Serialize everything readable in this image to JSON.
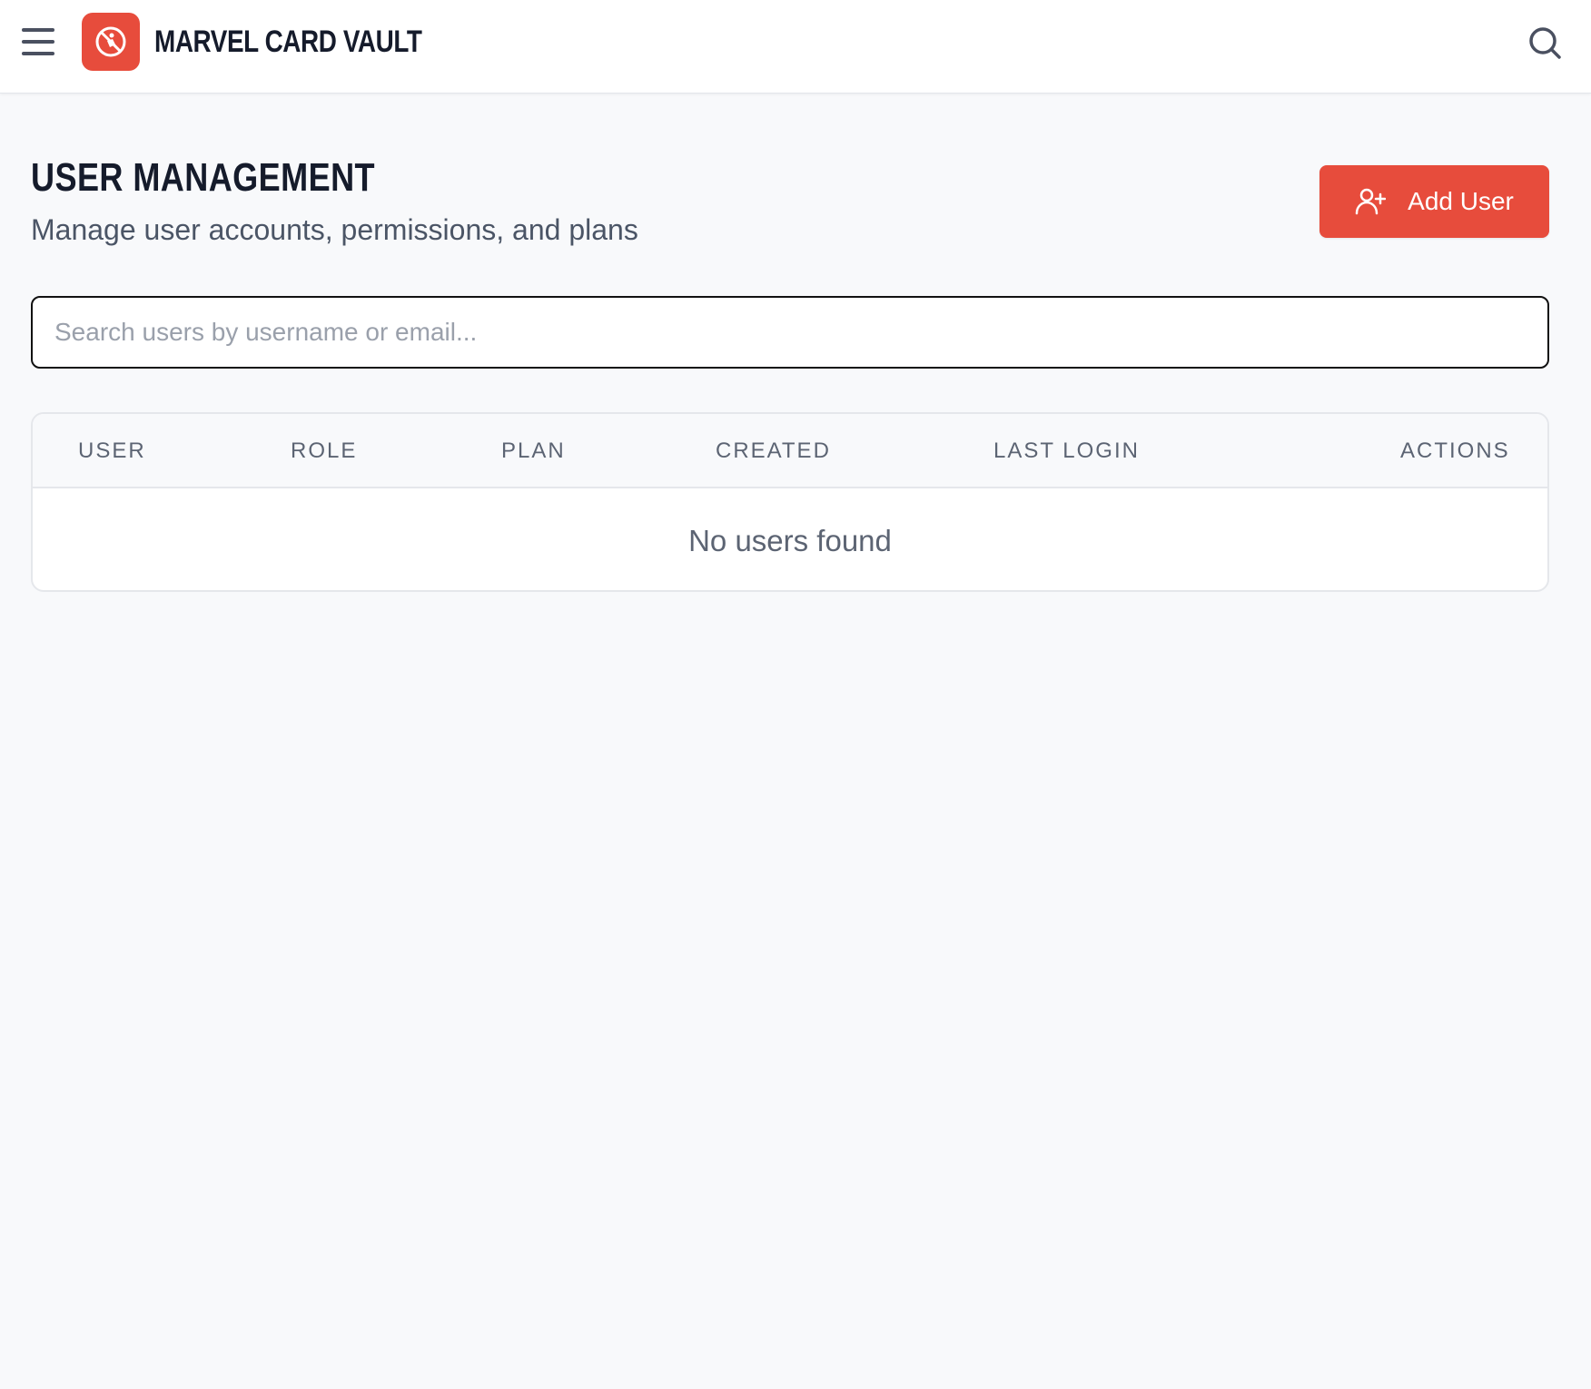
{
  "app": {
    "brand": "MARVEL CARD VAULT",
    "accent_color": "#e74c3c"
  },
  "header": {
    "menu_icon": "hamburger-menu-icon",
    "search_icon": "search-icon",
    "logo_icon": "no-symbol-logo-icon"
  },
  "page": {
    "title": "USER MANAGEMENT",
    "subtitle": "Manage user accounts, permissions, and plans",
    "add_button_label": "Add User",
    "add_button_icon": "user-plus-icon"
  },
  "search": {
    "placeholder": "Search users by username or email...",
    "value": ""
  },
  "table": {
    "columns": [
      "USER",
      "ROLE",
      "PLAN",
      "CREATED",
      "LAST LOGIN",
      "ACTIONS"
    ],
    "rows": [],
    "empty_message": "No users found"
  }
}
